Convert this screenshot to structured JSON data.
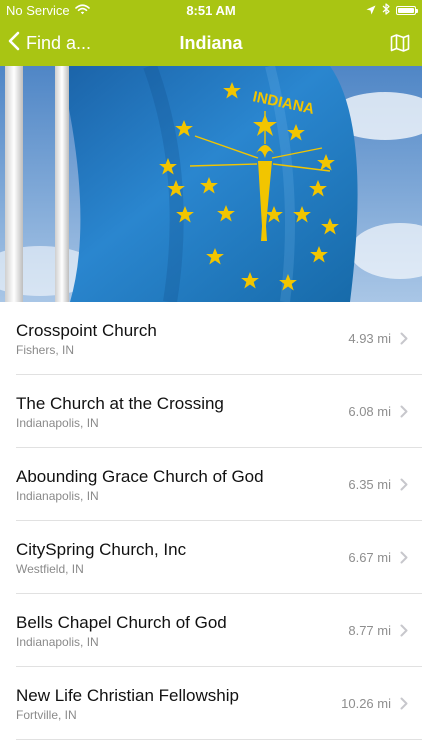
{
  "status_bar": {
    "carrier": "No Service",
    "time": "8:51 AM",
    "battery_level": 1.0
  },
  "nav": {
    "back_label": "Find a...",
    "title": "Indiana",
    "map_icon": "map-icon"
  },
  "hero": {
    "flag_text": "INDIANA"
  },
  "colors": {
    "accent": "#a9c513",
    "flag_blue": "#1f70b8",
    "flag_gold": "#f2c500"
  },
  "churches": [
    {
      "name": "Crosspoint Church",
      "location": "Fishers, IN",
      "distance": "4.93 mi"
    },
    {
      "name": "The Church at the Crossing",
      "location": "Indianapolis, IN",
      "distance": "6.08 mi"
    },
    {
      "name": "Abounding Grace Church of God",
      "location": "Indianapolis, IN",
      "distance": "6.35 mi"
    },
    {
      "name": "CitySpring Church, Inc",
      "location": "Westfield, IN",
      "distance": "6.67 mi"
    },
    {
      "name": "Bells Chapel Church of God",
      "location": "Indianapolis, IN",
      "distance": "8.77 mi"
    },
    {
      "name": "New Life Christian Fellowship",
      "location": "Fortville, IN",
      "distance": "10.26 mi"
    }
  ]
}
